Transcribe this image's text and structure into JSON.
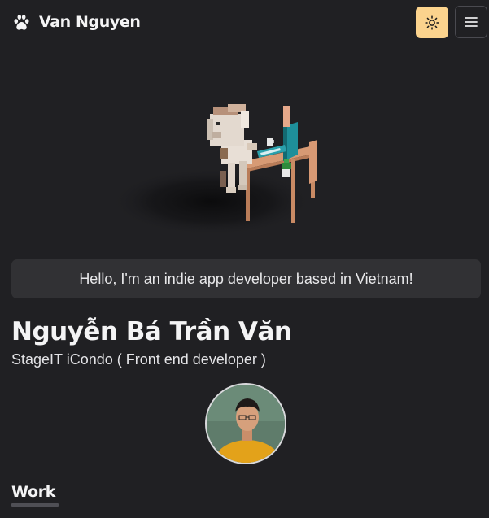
{
  "navbar": {
    "site_title": "Van Nguyen",
    "logo_icon": "paw-icon",
    "theme_toggle_icon": "sun-icon",
    "menu_icon": "hamburger-menu-icon"
  },
  "hero": {
    "illustration": "voxel-dog-at-desk",
    "greeting": "Hello, I'm an indie app developer based in Vietnam!"
  },
  "profile": {
    "name": "Nguyễn Bá Trần Văn",
    "role": "StageIT iCondo ( Front end developer )",
    "avatar": "profile-photo"
  },
  "sections": {
    "work_title": "Work"
  },
  "colors": {
    "background": "#202023",
    "accent_theme_button": "#fbd38d",
    "card_background": "#313134",
    "underline": "#4f4f55"
  }
}
